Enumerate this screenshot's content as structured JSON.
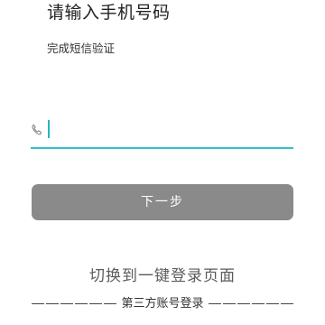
{
  "header": {
    "title": "请输入手机号码",
    "subtitle": "完成短信验证"
  },
  "phone": {
    "value": "",
    "placeholder": "",
    "icon": "phone-icon",
    "accent_color": "#35c0c7"
  },
  "next_button": {
    "label": "下一步",
    "color": "#8a8a8a"
  },
  "switch_link": {
    "label": "切换到一键登录页面"
  },
  "third_party": {
    "label": "第三方账号登录"
  }
}
